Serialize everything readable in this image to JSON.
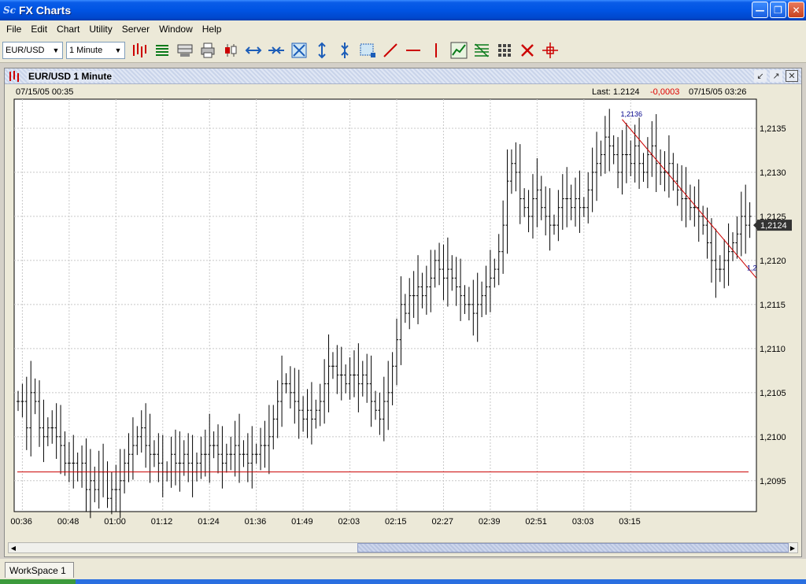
{
  "window": {
    "title": "FX Charts",
    "app_icon": "Sc"
  },
  "menu": [
    "File",
    "Edit",
    "Chart",
    "Utility",
    "Server",
    "Window",
    "Help"
  ],
  "toolbar": {
    "symbol": "EUR/USD",
    "interval": "1 Minute",
    "icons": [
      "bar-chart-icon",
      "list-icon",
      "monitor-icon",
      "print-icon",
      "candle-icon",
      "expand-h-icon",
      "compress-h-icon",
      "fit-icon",
      "expand-v-icon",
      "compress-v-icon",
      "zoom-rect-icon",
      "trend-line-icon",
      "horizontal-line-icon",
      "vertical-line-icon",
      "indicator-icon",
      "fibonacci-icon",
      "grid-icon",
      "delete-icon",
      "crosshair-icon"
    ]
  },
  "chart_window": {
    "title": "EUR/USD 1 Minute",
    "start_time": "07/15/05 00:35",
    "last_label": "Last: 1.2124",
    "change": "-0,0003",
    "end_time": "07/15/05 03:26"
  },
  "workspace_tab": "WorkSpace 1",
  "colors": {
    "line": "#cc0000",
    "bars": "#000000",
    "grid": "#c8c8c8",
    "accent": "#0054e3"
  },
  "chart_data": {
    "type": "bar",
    "subtype": "ohlc",
    "y_ticks": [
      "1,2095",
      "1,2100",
      "1,2105",
      "1,2110",
      "1,2115",
      "1,2120",
      "1,2125",
      "1,2130",
      "1,2135"
    ],
    "x_ticks": [
      "00:36",
      "00:48",
      "01:00",
      "01:12",
      "01:24",
      "01:36",
      "01:49",
      "02:03",
      "02:15",
      "02:27",
      "02:39",
      "02:51",
      "03:03",
      "03:15"
    ],
    "ylim": [
      1.20915,
      1.21383
    ],
    "last_price_label": "1,2124",
    "last_price": 1.2124,
    "high_label": "1,2136",
    "high_price": 1.2136,
    "horizontal_line": 1.2096,
    "trend_line": {
      "from": {
        "bar": 142,
        "price": 1.2136
      },
      "to": {
        "bar": 170,
        "price": 1.2118
      },
      "end_label": "1,2"
    },
    "bars_close": [
      1.2104,
      1.2104,
      1.2101,
      1.2105,
      1.2104,
      1.2101,
      1.21,
      1.2101,
      1.2101,
      1.21,
      1.2099,
      1.2097,
      1.2097,
      1.2097,
      1.2096,
      1.2097,
      1.2094,
      1.2095,
      1.2094,
      1.2096,
      1.2096,
      1.2093,
      1.2094,
      1.2094,
      1.2095,
      1.2097,
      1.2098,
      1.2099,
      1.21,
      1.2101,
      1.2099,
      1.2098,
      1.2098,
      1.2097,
      1.2096,
      1.2096,
      1.2098,
      1.2097,
      1.2097,
      1.2098,
      1.2097,
      1.2096,
      1.2097,
      1.2098,
      1.2098,
      1.2099,
      1.2099,
      1.2098,
      1.2097,
      1.2098,
      1.2098,
      1.2099,
      1.2098,
      1.2098,
      1.2097,
      1.2098,
      1.2098,
      1.2099,
      1.2099,
      1.21,
      1.2102,
      1.2104,
      1.2106,
      1.2106,
      1.2105,
      1.2104,
      1.2103,
      1.2102,
      1.2103,
      1.2102,
      1.2103,
      1.2104,
      1.2106,
      1.2108,
      1.2108,
      1.2107,
      1.2107,
      1.2106,
      1.2107,
      1.2107,
      1.2106,
      1.2107,
      1.2106,
      1.2104,
      1.2103,
      1.2102,
      1.2104,
      1.2105,
      1.2108,
      1.2111,
      1.2115,
      1.2114,
      1.2116,
      1.2116,
      1.2117,
      1.2116,
      1.2117,
      1.2118,
      1.212,
      1.2119,
      1.2118,
      1.2119,
      1.2118,
      1.2117,
      1.2116,
      1.2115,
      1.2115,
      1.2114,
      1.2115,
      1.2116,
      1.2117,
      1.2118,
      1.2119,
      1.2121,
      1.2124,
      1.2129,
      1.2131,
      1.213,
      1.2127,
      1.2126,
      1.2125,
      1.2127,
      1.2128,
      1.2126,
      1.2125,
      1.2124,
      1.2124,
      1.2126,
      1.2127,
      1.2127,
      1.2126,
      1.2127,
      1.2126,
      1.2126,
      1.2128,
      1.213,
      1.2131,
      1.2132,
      1.2134,
      1.2133,
      1.2132,
      1.213,
      1.2132,
      1.2132,
      1.2131,
      1.2133,
      1.2131,
      1.213,
      1.2132,
      1.2133,
      1.2131,
      1.213,
      1.213,
      1.2131,
      1.2129,
      1.2128,
      1.2127,
      1.2127,
      1.2126,
      1.2126,
      1.2125,
      1.2124,
      1.2122,
      1.212,
      1.2119,
      1.2119,
      1.212,
      1.2121,
      1.2122,
      1.2123,
      1.2125,
      1.2124,
      1.2125
    ]
  }
}
